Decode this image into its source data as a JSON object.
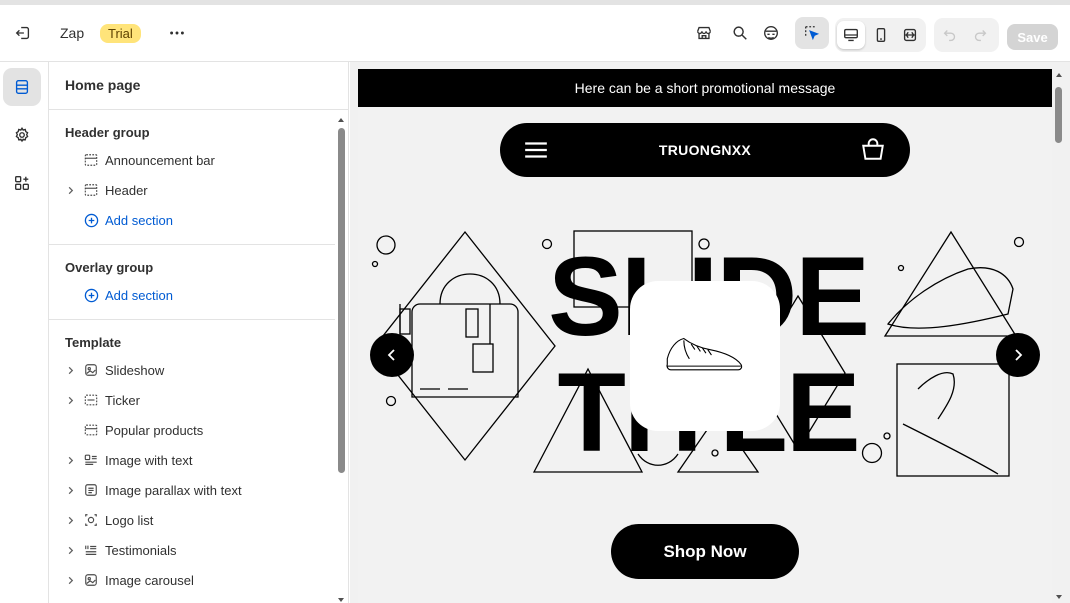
{
  "topbar": {
    "app_name": "Zap",
    "badge": "Trial",
    "save_label": "Save",
    "icons": [
      "exit-icon",
      "more-icon",
      "store-icon",
      "search-icon",
      "ai-icon",
      "inspector-icon",
      "desktop-icon",
      "mobile-icon",
      "fullwidth-icon",
      "undo-icon",
      "redo-icon"
    ]
  },
  "rail": {
    "icons": [
      "sections-icon",
      "settings-icon",
      "apps-icon"
    ]
  },
  "panel": {
    "title": "Home page",
    "groups": [
      {
        "title": "Header group",
        "items": [
          {
            "label": "Announcement bar",
            "icon": "announcement-icon"
          },
          {
            "label": "Header",
            "icon": "header-icon",
            "expandable": true
          }
        ],
        "add_label": "Add section"
      },
      {
        "title": "Overlay group",
        "items": [],
        "add_label": "Add section"
      },
      {
        "title": "Template",
        "items": [
          {
            "label": "Slideshow",
            "icon": "slideshow-icon",
            "expandable": true
          },
          {
            "label": "Ticker",
            "icon": "ticker-icon",
            "expandable": true
          },
          {
            "label": "Popular products",
            "icon": "products-icon"
          },
          {
            "label": "Image with text",
            "icon": "image-text-icon",
            "expandable": true
          },
          {
            "label": "Image parallax with text",
            "icon": "parallax-icon",
            "expandable": true
          },
          {
            "label": "Logo list",
            "icon": "logo-list-icon",
            "expandable": true
          },
          {
            "label": "Testimonials",
            "icon": "testimonials-icon",
            "expandable": true
          },
          {
            "label": "Image carousel",
            "icon": "carousel-icon",
            "expandable": true
          }
        ]
      }
    ]
  },
  "preview": {
    "announcement": "Here can be a short promotional message",
    "store_name": "TRUONGNXX",
    "slide_title_line1": "SLIDE",
    "slide_title_line2": "TITLE",
    "button_label": "Shop Now"
  },
  "colors": {
    "accent": "#005bd3",
    "badge_bg": "#ffe47a",
    "store_black": "#000000"
  }
}
